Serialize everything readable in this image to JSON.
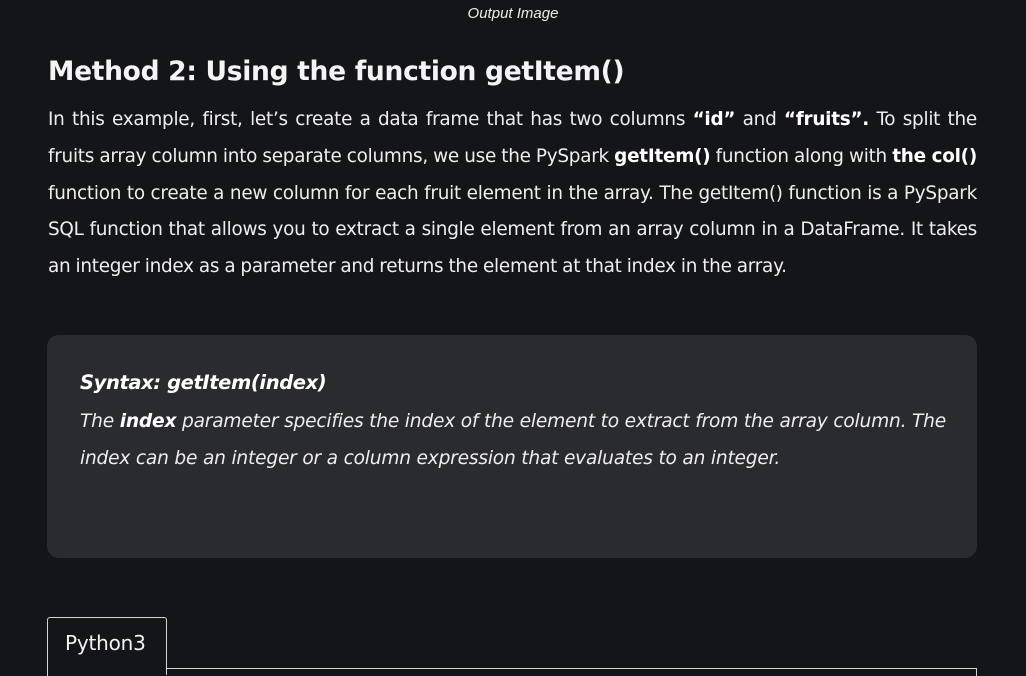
{
  "caption": "Output Image",
  "heading": "Method 2: Using the function getItem()",
  "intro": {
    "t1": "In this example, first, let’s create a data frame that has two columns ",
    "b1": "“id”",
    "t2": " and ",
    "b2": "“fruits”.",
    "t3": " To split the fruits array column into separate columns, we use the PySpark ",
    "b3": "getItem()",
    "t4": " function along with ",
    "b4": "the col()",
    "t5": " function to create a new column for each fruit element in the array. The getItem() function is a PySpark SQL function that allows you to extract a single element from an array column in a DataFrame. It takes an integer index as a parameter and returns the element at that index in the array."
  },
  "syntax": {
    "title": "Syntax: getItem(index)",
    "desc_1": "The ",
    "desc_bold": "index",
    "desc_2": " parameter specifies the index of the element to extract from the array column. The index can be an integer or a column expression that evaluates to an integer."
  },
  "code_tab": {
    "label": "Python3"
  }
}
